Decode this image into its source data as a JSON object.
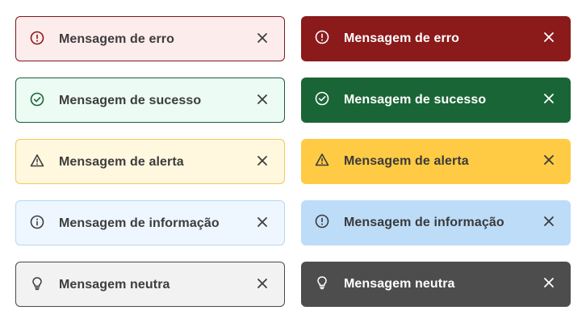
{
  "alerts_light": [
    {
      "message": "Mensagem de erro",
      "icon": "error-circle-icon",
      "accent": "#8b1a1a"
    },
    {
      "message": "Mensagem de sucesso",
      "icon": "check-circle-icon",
      "accent": "#1a6536"
    },
    {
      "message": "Mensagem de alerta",
      "icon": "warning-triangle-icon",
      "accent": "#3d3d3d"
    },
    {
      "message": "Mensagem de informação",
      "icon": "info-circle-icon",
      "accent": "#3d3d3d"
    },
    {
      "message": "Mensagem neutra",
      "icon": "lightbulb-icon",
      "accent": "#3d3d3d"
    }
  ],
  "alerts_dark": [
    {
      "message": "Mensagem de erro",
      "icon": "error-circle-icon",
      "accent": "#ffffff"
    },
    {
      "message": "Mensagem de sucesso",
      "icon": "check-circle-icon",
      "accent": "#ffffff"
    },
    {
      "message": "Mensagem de alerta",
      "icon": "warning-triangle-icon",
      "accent": "#3a3a3a"
    },
    {
      "message": "Mensagem de informação",
      "icon": "error-circle-icon",
      "accent": "#3a3a3a"
    },
    {
      "message": "Mensagem neutra",
      "icon": "lightbulb-icon",
      "accent": "#ffffff"
    }
  ],
  "colors": {
    "error_bg_light": "#fdecec",
    "success_bg_light": "#ecfbf3",
    "warning_bg_light": "#fff7de",
    "info_bg_light": "#eef6ff",
    "neutral_bg_light": "#f2f2f2",
    "error_bg_dark": "#8b1a1a",
    "success_bg_dark": "#1a6536",
    "warning_bg_dark": "#ffcb45",
    "info_bg_dark": "#bddcf8",
    "neutral_bg_dark": "#4d4d4d"
  }
}
